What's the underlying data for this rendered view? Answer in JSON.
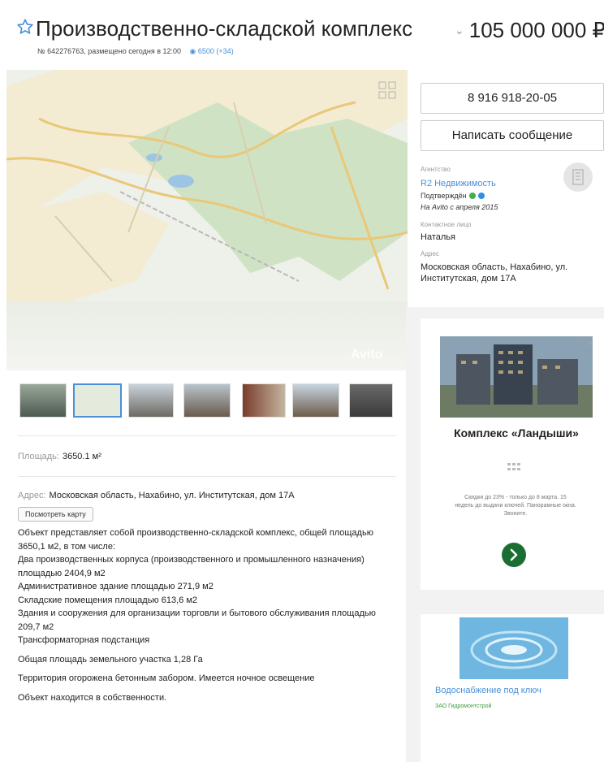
{
  "header": {
    "title": "Производственно-складской комплекс",
    "meta": "№ 642276763, размещено сегодня в 12:00",
    "views": "6500 (+34)",
    "price": "105 000 000 ₽"
  },
  "gallery": {
    "watermark": "Avito"
  },
  "params": {
    "area_label": "Площадь:",
    "area_value": "3650.1 м²",
    "address_label": "Адрес:",
    "address_value": "Московская область, Нахабино, ул. Институтская, дом 17А",
    "map_button": "Посмотреть карту"
  },
  "description": [
    "Объект представляет собой производственно-складской комплекс, общей площадью 3650,1 м2, в том числе:",
    "Два производственных корпуса (производственного и промышленного назначения) площадью 2404,9 м2",
    "Административное здание площадью 271,9 м2",
    "Складские помещения площадью 613,6 м2",
    "Здания и сооружения для организации торговли и бытового обслуживания площадью 209,7 м2",
    "Трансформаторная подстанция",
    "Общая площадь земельного участка 1,28 Га",
    "Территория огорожена бетонным забором. Имеется ночное освещение",
    "Объект находится в собственности."
  ],
  "sidebar": {
    "phone": "8 916 918-20-05",
    "message_button": "Написать сообщение",
    "agency_label": "Агентство",
    "agency_name": "R2 Недвижимость",
    "verified": "Подтверждён",
    "since": "На Avito с апреля 2015",
    "contact_label": "Контактное лицо",
    "contact_name": "Наталья",
    "address_label": "Адрес",
    "address_value": "Московская область, Нахабино, ул. Институтская, дом 17А"
  },
  "ad1": {
    "title": "Комплекс «Ландыши»",
    "text": "Скидки до 23% - только до 8 марта. 15 недель до выдачи ключей. Панорамные окна. Звоните."
  },
  "ad2": {
    "title": "Водоснабжение под ключ",
    "subtitle": "ЗАО Гидромонтстрой"
  },
  "colors": {
    "accent": "#4a90d9",
    "ad_button": "#1b6e32",
    "verified_green": "#44b044",
    "verified_blue": "#2d8ee6"
  }
}
